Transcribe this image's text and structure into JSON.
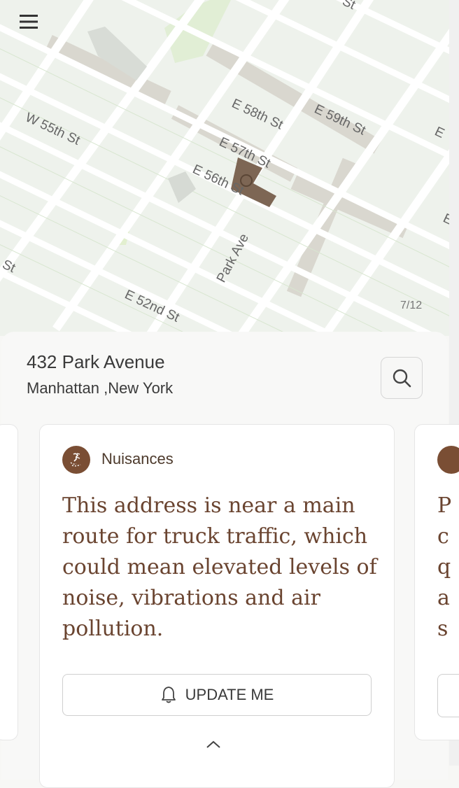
{
  "map": {
    "street_labels": {
      "e58": "E 58th St",
      "e59": "E 59th St",
      "e57": "E 57th St",
      "e56": "E 56th St",
      "w55": "W 55th St",
      "park": "Park Ave",
      "e52": "E 52nd St",
      "st_left": "St",
      "st_top": "St",
      "e_right_top": "E",
      "e_right_mid": "E"
    },
    "counter": "7/12"
  },
  "location": {
    "address": "432 Park Avenue",
    "area": "Manhattan ,New York"
  },
  "card": {
    "category": "Nuisances",
    "text": "This address is near a main route for truck traffic, which could mean elevated levels of noise, vibrations and air pollution.",
    "button_label": "UPDATE ME"
  },
  "next_card": {
    "text_fragment": "P\nc\nq\na\ns"
  },
  "colors": {
    "accent": "#7a4e34",
    "text_brown": "#6a4430",
    "building": "#7d6654"
  },
  "icons": {
    "menu": "hamburger-icon",
    "search": "search-icon",
    "badge": "nuisance-icon",
    "bell": "bell-icon",
    "chevron": "chevron-up-icon"
  }
}
